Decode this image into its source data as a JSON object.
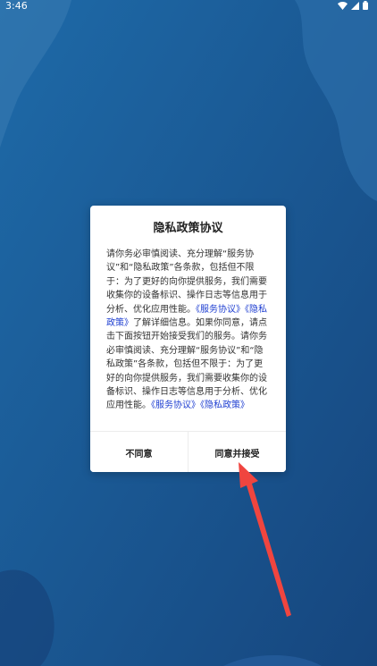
{
  "status_bar": {
    "time": "3:46",
    "icons": [
      "wifi-icon",
      "signal-icon",
      "battery-icon"
    ]
  },
  "dialog": {
    "title": "隐私政策协议",
    "body_text_1": "请你务必审慎阅读、充分理解“服务协议”和“隐私政策”各条款，包括但不限于：为了更好的向你提供服务，我们需要收集你的设备标识、操作日志等信息用于分析、优化应用性能。",
    "link_service": "《服务协议》",
    "link_privacy": "《隐私政策》",
    "body_text_2": "了解详细信息。如果你同意，请点击下面按钮开始接受我们的服务。请你务必审慎阅读、充分理解“服务协议”和“隐私政策”各条款，包括但不限于：为了更好的向你提供服务，我们需要收集你的设备标识、操作日志等信息用于分析、优化应用性能。",
    "link_service_2": "《服务协议》",
    "link_privacy_2": "《隐私政策》",
    "decline_label": "不同意",
    "accept_label": "同意并接受"
  },
  "colors": {
    "background": "#1d5a92",
    "link": "#1f3fd1",
    "arrow": "#f0453f"
  }
}
